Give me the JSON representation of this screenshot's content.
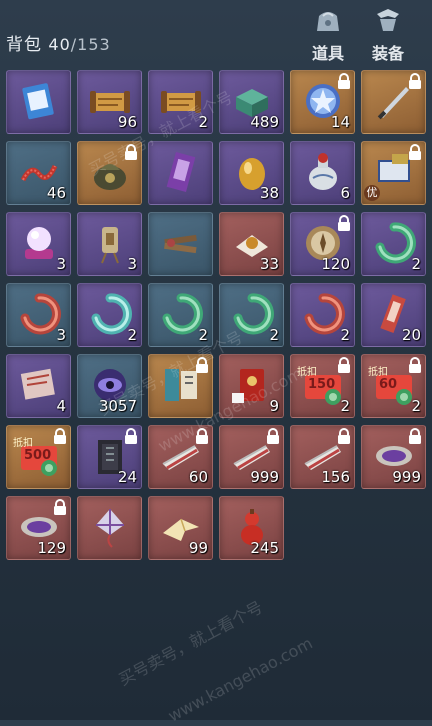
{
  "header": {
    "title": "背包",
    "count": "40",
    "total": "/153",
    "tabs": [
      {
        "label": "道具",
        "icon": "bag-icon"
      },
      {
        "label": "装备",
        "icon": "equipment-icon"
      }
    ]
  },
  "slots": [
    {
      "icon": "discount-ticket-icon",
      "quality": "purple",
      "qty": "",
      "locked": false
    },
    {
      "icon": "golden-scroll-icon",
      "quality": "purple",
      "qty": "96",
      "locked": false
    },
    {
      "icon": "golden-scroll-icon",
      "quality": "purple",
      "qty": "2",
      "locked": false
    },
    {
      "icon": "jade-box-icon",
      "quality": "purple",
      "qty": "489",
      "locked": false
    },
    {
      "icon": "star-badge-icon",
      "quality": "orange",
      "qty": "14",
      "locked": true
    },
    {
      "icon": "blade-icon",
      "quality": "orange",
      "qty": "",
      "locked": true
    },
    {
      "icon": "red-rope-icon",
      "quality": "blue",
      "qty": "46",
      "locked": false
    },
    {
      "icon": "bag-pouch-icon",
      "quality": "orange",
      "qty": "",
      "locked": true
    },
    {
      "icon": "purple-scroll-icon",
      "quality": "purple",
      "qty": "",
      "locked": false
    },
    {
      "icon": "golden-egg-icon",
      "quality": "purple",
      "qty": "38",
      "locked": false
    },
    {
      "icon": "porcelain-jar-icon",
      "quality": "purple",
      "qty": "6",
      "locked": false
    },
    {
      "icon": "blue-book-icon",
      "quality": "orange",
      "qty": "",
      "locked": true,
      "badge": "优"
    },
    {
      "icon": "crystal-ball-icon",
      "quality": "purple",
      "qty": "3",
      "locked": false
    },
    {
      "icon": "lantern-icon",
      "quality": "purple",
      "qty": "3",
      "locked": false
    },
    {
      "icon": "tool-bundle-icon",
      "quality": "blue",
      "qty": "",
      "locked": false
    },
    {
      "icon": "food-plate-icon",
      "quality": "red",
      "qty": "33",
      "locked": false
    },
    {
      "icon": "compass-icon",
      "quality": "purple",
      "qty": "120",
      "locked": true
    },
    {
      "icon": "green-jade-ring-icon",
      "quality": "purple",
      "qty": "2",
      "locked": false
    },
    {
      "icon": "red-jade-ring-icon",
      "quality": "blue",
      "qty": "3",
      "locked": false
    },
    {
      "icon": "cyan-jade-ring-icon",
      "quality": "purple",
      "qty": "2",
      "locked": false
    },
    {
      "icon": "green-jade-ring-icon",
      "quality": "blue",
      "qty": "2",
      "locked": false
    },
    {
      "icon": "green-jade-ring-icon",
      "quality": "blue",
      "qty": "2",
      "locked": false
    },
    {
      "icon": "red-jade-ring-icon",
      "quality": "purple",
      "qty": "2",
      "locked": false
    },
    {
      "icon": "red-tag-icon",
      "quality": "purple",
      "qty": "20",
      "locked": false
    },
    {
      "icon": "red-letter-icon",
      "quality": "purple",
      "qty": "4",
      "locked": false
    },
    {
      "icon": "eye-orb-icon",
      "quality": "blue",
      "qty": "3057",
      "locked": false
    },
    {
      "icon": "manual-book-icon",
      "quality": "orange",
      "qty": "",
      "locked": true
    },
    {
      "icon": "red-envelope-icon",
      "quality": "red",
      "qty": "9",
      "locked": false
    },
    {
      "icon": "voucher-icon",
      "quality": "red",
      "qty": "2",
      "locked": true,
      "voucher": {
        "top": "抵扣",
        "value": "150"
      }
    },
    {
      "icon": "voucher-icon",
      "quality": "red",
      "qty": "2",
      "locked": true,
      "voucher": {
        "top": "抵扣",
        "value": "60"
      }
    },
    {
      "icon": "voucher-icon",
      "quality": "orange",
      "qty": "",
      "locked": true,
      "voucher": {
        "top": "抵扣",
        "value": "500"
      }
    },
    {
      "icon": "dark-tome-icon",
      "quality": "purple",
      "qty": "24",
      "locked": true
    },
    {
      "icon": "fan-book-icon",
      "quality": "red",
      "qty": "60",
      "locked": true
    },
    {
      "icon": "fan-book-icon",
      "quality": "red",
      "qty": "999",
      "locked": true
    },
    {
      "icon": "fan-book-icon",
      "quality": "red",
      "qty": "156",
      "locked": true
    },
    {
      "icon": "purple-bowl-icon",
      "quality": "red",
      "qty": "999",
      "locked": true
    },
    {
      "icon": "purple-bowl-icon",
      "quality": "red",
      "qty": "129",
      "locked": true
    },
    {
      "icon": "kite-icon",
      "quality": "red",
      "qty": "",
      "locked": false
    },
    {
      "icon": "paper-crane-icon",
      "quality": "red",
      "qty": "99",
      "locked": false
    },
    {
      "icon": "red-gourd-icon",
      "quality": "red",
      "qty": "245",
      "locked": false
    }
  ],
  "watermarks": [
    "买号卖号，就上看个号",
    "www.kangehao.com",
    "看个号"
  ],
  "colors": {
    "lock": "#ffffff",
    "quantity": "#ffffff"
  }
}
